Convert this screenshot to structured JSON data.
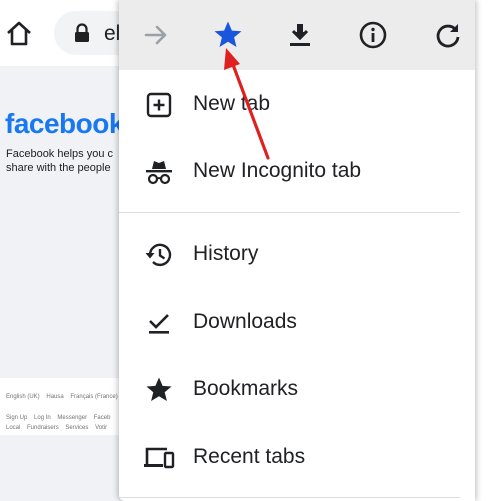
{
  "browser": {
    "url_partial": "el"
  },
  "facebook": {
    "logo": "facebook",
    "tagline_line1": "Facebook helps you c",
    "tagline_line2": "share with the people",
    "languages": [
      "English (UK)",
      "Hausa",
      "Français (France)"
    ],
    "links_row1": [
      "Sign Up",
      "Log In",
      "Messenger",
      "Faceb"
    ],
    "links_row2": [
      "Local",
      "Fundraisers",
      "Services",
      "Votir"
    ]
  },
  "menu": {
    "toolbar": {
      "forward_icon": "arrow-forward-icon",
      "bookmark_icon": "star-icon",
      "bookmark_color": "#1a56db",
      "download_icon": "download-icon",
      "info_icon": "info-icon",
      "refresh_icon": "refresh-icon"
    },
    "items": [
      {
        "label": "New tab",
        "icon": "new-tab-icon"
      },
      {
        "label": "New Incognito tab",
        "icon": "incognito-icon"
      },
      {
        "label": "History",
        "icon": "history-icon"
      },
      {
        "label": "Downloads",
        "icon": "downloads-check-icon"
      },
      {
        "label": "Bookmarks",
        "icon": "bookmarks-star-icon"
      },
      {
        "label": "Recent tabs",
        "icon": "devices-icon"
      }
    ]
  },
  "annotation": {
    "arrow_color": "#e02020"
  }
}
